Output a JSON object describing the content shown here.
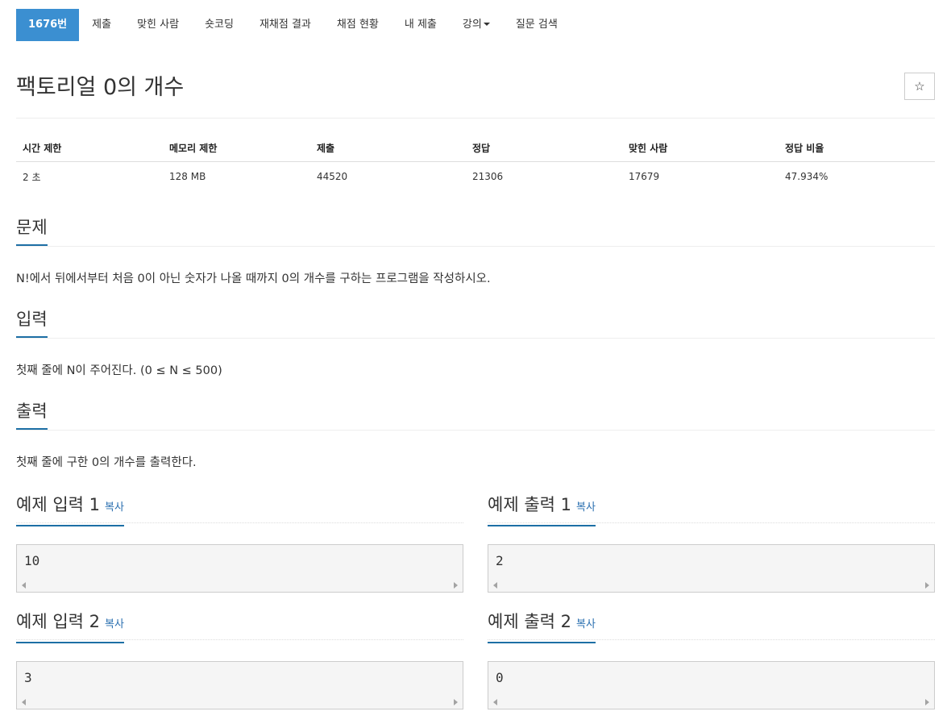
{
  "tabs": [
    {
      "label": "1676번",
      "active": true
    },
    {
      "label": "제출"
    },
    {
      "label": "맞힌 사람"
    },
    {
      "label": "숏코딩"
    },
    {
      "label": "재채점 결과"
    },
    {
      "label": "채점 현황"
    },
    {
      "label": "내 제출"
    },
    {
      "label": "강의",
      "dropdown": true
    },
    {
      "label": "질문 검색"
    }
  ],
  "problem": {
    "title": "팩토리얼 0의 개수",
    "star_icon": "☆"
  },
  "stats": {
    "headers": [
      "시간 제한",
      "메모리 제한",
      "제출",
      "정답",
      "맞힌 사람",
      "정답 비율"
    ],
    "values": [
      "2 초",
      "128 MB",
      "44520",
      "21306",
      "17679",
      "47.934%"
    ]
  },
  "sections": {
    "description": {
      "heading": "문제",
      "text": "N!에서 뒤에서부터 처음 0이 아닌 숫자가 나올 때까지 0의 개수를 구하는 프로그램을 작성하시오."
    },
    "input": {
      "heading": "입력",
      "text": "첫째 줄에 N이 주어진다. (0 ≤ N ≤ 500)"
    },
    "output": {
      "heading": "출력",
      "text": "첫째 줄에 구한 0의 개수를 출력한다."
    }
  },
  "copy_label": "복사",
  "samples": [
    {
      "heading": "예제 입력 1",
      "value": "10"
    },
    {
      "heading": "예제 출력 1",
      "value": "2"
    },
    {
      "heading": "예제 입력 2",
      "value": "3"
    },
    {
      "heading": "예제 출력 2",
      "value": "0"
    }
  ],
  "colors": {
    "accent": "#3b8fd1",
    "underline": "#1d6fa5",
    "link": "#2a6fb0",
    "sample_bg": "#f5f5f5"
  }
}
